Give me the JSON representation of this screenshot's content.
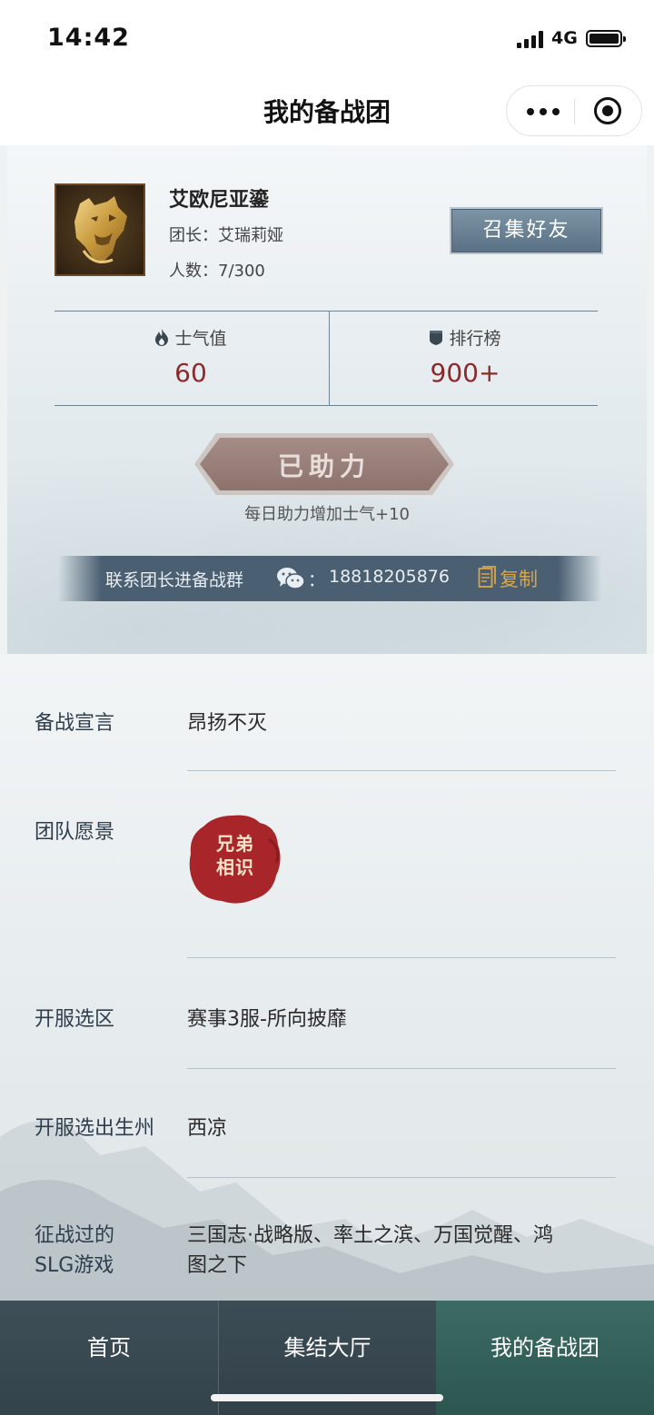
{
  "status_bar": {
    "time": "14:42",
    "network": "4G"
  },
  "nav": {
    "title": "我的备战团"
  },
  "team": {
    "name": "艾欧尼亚鎏",
    "leader": "团长：艾瑞莉娅",
    "members": "人数：7/300",
    "gather_button": "召集好友",
    "stats": {
      "morale_label": "士气值",
      "morale_value": "60",
      "rank_label": "排行榜",
      "rank_value": "900+"
    },
    "assist_button": "已助力",
    "assist_note": "每日助力增加士气+10",
    "contact": {
      "text": "联系团长进备战群",
      "colon": "：",
      "phone": "18818205876",
      "copy_label": "复制"
    }
  },
  "info": {
    "declaration_label": "备战宣言",
    "declaration_value": "昂扬不灭",
    "vision_label": "团队愿景",
    "vision_seal": "兄弟相识",
    "vision_seal_line1": "兄弟",
    "vision_seal_line2": "相识",
    "server_label": "开服选区",
    "server_value": "赛事3服-所向披靡",
    "state_label": "开服选出生州",
    "state_value": "西凉",
    "games_label_line1": "征战过的",
    "games_label_line2": "SLG游戏",
    "games_value_line1": "三国志·战略版、率土之滨、万国觉醒、鸿",
    "games_value_line2": "图之下"
  },
  "tabs": [
    {
      "label": "首页",
      "active": false
    },
    {
      "label": "集结大厅",
      "active": false
    },
    {
      "label": "我的备战团",
      "active": true
    }
  ],
  "colors": {
    "accent_red": "#8b2a2a",
    "gather_button": "#6a8296",
    "contact_bar": "#4a5f72",
    "copy_gold": "#d7a64a",
    "active_tab": "#2f5b55",
    "seal_red": "#a8262a"
  }
}
